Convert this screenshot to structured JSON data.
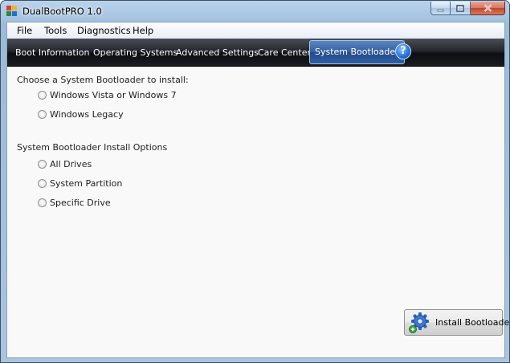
{
  "window": {
    "title": "DualBootPRO 1.0"
  },
  "menubar": {
    "items": [
      "File",
      "Tools",
      "Diagnostics",
      "Help"
    ]
  },
  "nav": {
    "tabs": [
      "Boot Information",
      "Operating Systems",
      "Advanced Settings",
      "Care Center",
      "System Bootloader"
    ],
    "active_tab": "System Bootloader",
    "help_glyph": "?"
  },
  "bootloader": {
    "choose_label": "Choose a System Bootloader to install:",
    "options": [
      "Windows Vista or Windows 7",
      "Windows Legacy"
    ]
  },
  "install_options": {
    "label": "System Bootloader Install Options",
    "options": [
      "All Drives",
      "System Partition",
      "Specific Drive"
    ]
  },
  "actions": {
    "install_label": "Install Bootloader"
  },
  "icons": {
    "app": "dualboot-app-icon",
    "help": "help-icon",
    "install": "gear-install-icon",
    "minimize": "minimize-icon",
    "maximize": "maximize-icon",
    "close": "close-icon"
  }
}
